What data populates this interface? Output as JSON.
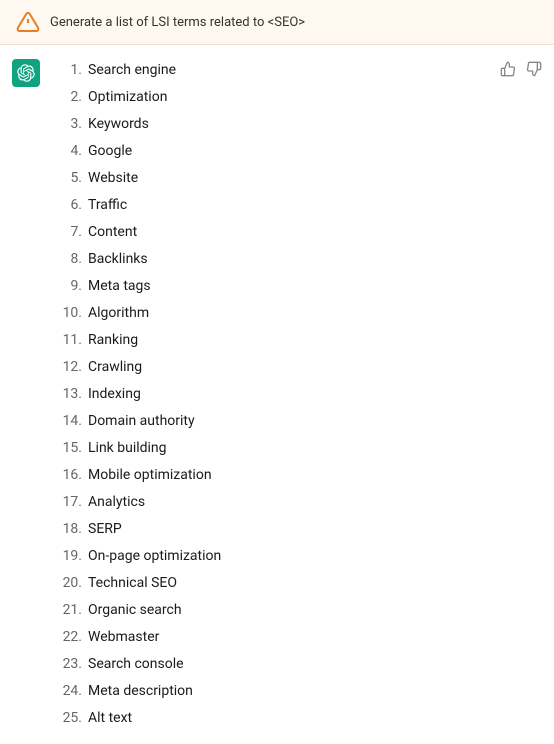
{
  "header": {
    "icon_alt": "warning-triangle",
    "text": "Generate a list of LSI terms related to <SEO>"
  },
  "response": {
    "avatar_alt": "chatgpt-logo",
    "items": [
      {
        "num": "1.",
        "text": "Search engine"
      },
      {
        "num": "2.",
        "text": "Optimization"
      },
      {
        "num": "3.",
        "text": "Keywords"
      },
      {
        "num": "4.",
        "text": "Google"
      },
      {
        "num": "5.",
        "text": "Website"
      },
      {
        "num": "6.",
        "text": "Traffic"
      },
      {
        "num": "7.",
        "text": "Content"
      },
      {
        "num": "8.",
        "text": "Backlinks"
      },
      {
        "num": "9.",
        "text": "Meta tags"
      },
      {
        "num": "10.",
        "text": "Algorithm"
      },
      {
        "num": "11.",
        "text": "Ranking"
      },
      {
        "num": "12.",
        "text": "Crawling"
      },
      {
        "num": "13.",
        "text": "Indexing"
      },
      {
        "num": "14.",
        "text": "Domain authority"
      },
      {
        "num": "15.",
        "text": "Link building"
      },
      {
        "num": "16.",
        "text": "Mobile optimization"
      },
      {
        "num": "17.",
        "text": "Analytics"
      },
      {
        "num": "18.",
        "text": "SERP"
      },
      {
        "num": "19.",
        "text": "On-page optimization"
      },
      {
        "num": "20.",
        "text": "Technical SEO"
      },
      {
        "num": "21.",
        "text": "Organic search"
      },
      {
        "num": "22.",
        "text": "Webmaster"
      },
      {
        "num": "23.",
        "text": "Search console"
      },
      {
        "num": "24.",
        "text": "Meta description"
      },
      {
        "num": "25.",
        "text": "Alt text"
      }
    ]
  },
  "actions": {
    "thumbup_label": "👍",
    "thumbdown_label": "👎"
  }
}
